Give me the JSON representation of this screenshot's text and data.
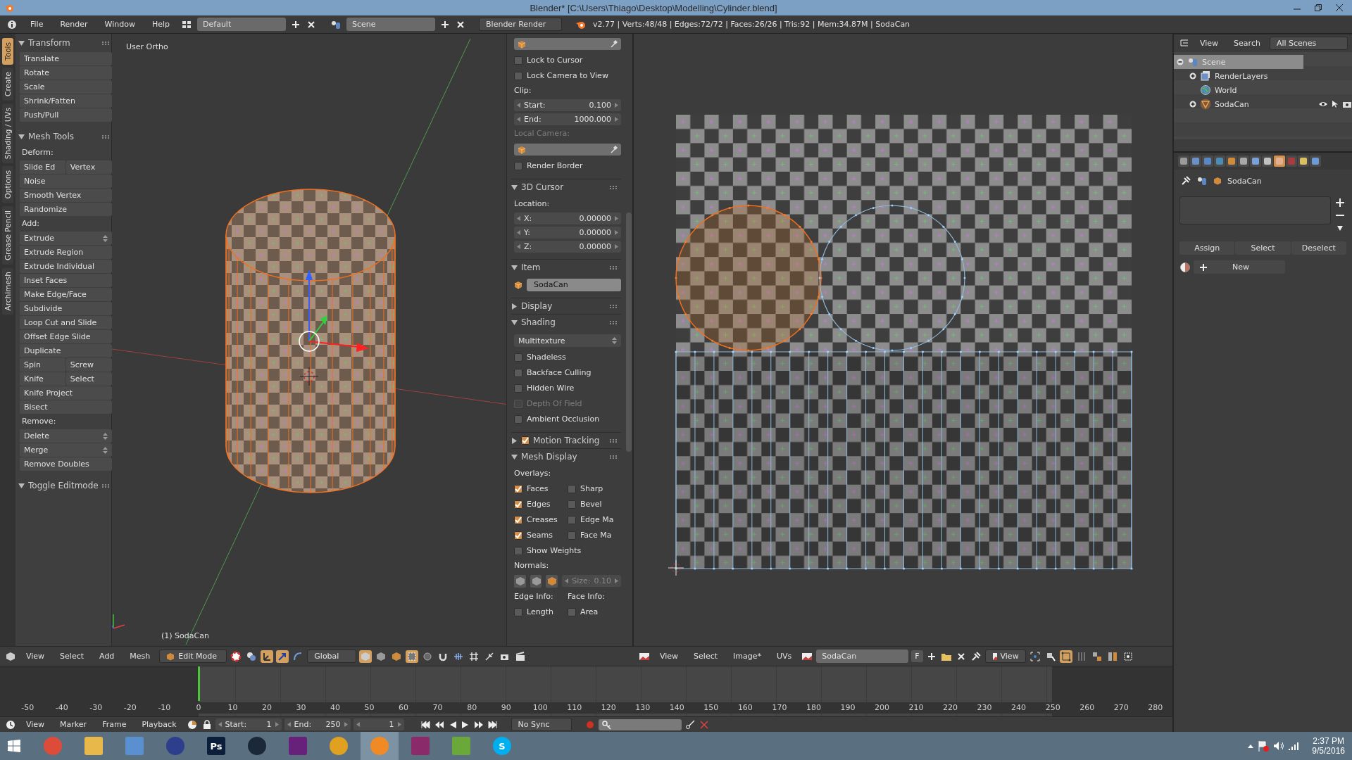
{
  "window": {
    "title": "Blender* [C:\\Users\\Thiago\\Desktop\\Modelling\\Cylinder.blend]"
  },
  "info_header": {
    "menus": [
      "File",
      "Render",
      "Window",
      "Help"
    ],
    "layout": "Default",
    "scene": "Scene",
    "engine": "Blender Render",
    "stats": "v2.77 | Verts:48/48 | Edges:72/72 | Faces:26/26 | Tris:92 | Mem:34.87M | SodaCan"
  },
  "tool_tabs": [
    {
      "label": "Tools",
      "selected": true
    },
    {
      "label": "Create",
      "selected": false
    },
    {
      "label": "Shading / UVs",
      "selected": false
    },
    {
      "label": "Options",
      "selected": false
    },
    {
      "label": "Grease Pencil",
      "selected": false
    },
    {
      "label": "Archimesh",
      "selected": false
    }
  ],
  "toolshelf": [
    {
      "title": "Transform",
      "expanded": true,
      "items": [
        {
          "kind": "button",
          "text": "Translate"
        },
        {
          "kind": "button",
          "text": "Rotate"
        },
        {
          "kind": "button",
          "text": "Scale"
        },
        {
          "kind": "button",
          "text": "Shrink/Fatten"
        },
        {
          "kind": "button",
          "text": "Push/Pull"
        }
      ]
    },
    {
      "title": "Mesh Tools",
      "expanded": true,
      "items": [
        {
          "kind": "label",
          "text": "Deform:"
        },
        {
          "kind": "pair",
          "texts": [
            "Slide Ed",
            "Vertex"
          ]
        },
        {
          "kind": "button",
          "text": "Noise"
        },
        {
          "kind": "button",
          "text": "Smooth Vertex"
        },
        {
          "kind": "button",
          "text": "Randomize"
        },
        {
          "kind": "label",
          "text": "Add:"
        },
        {
          "kind": "dropdown",
          "text": "Extrude"
        },
        {
          "kind": "button",
          "text": "Extrude Region"
        },
        {
          "kind": "button",
          "text": "Extrude Individual"
        },
        {
          "kind": "button",
          "text": "Inset Faces"
        },
        {
          "kind": "button",
          "text": "Make Edge/Face"
        },
        {
          "kind": "button",
          "text": "Subdivide"
        },
        {
          "kind": "button",
          "text": "Loop Cut and Slide"
        },
        {
          "kind": "button",
          "text": "Offset Edge Slide"
        },
        {
          "kind": "button",
          "text": "Duplicate"
        },
        {
          "kind": "pair",
          "texts": [
            "Spin",
            "Screw"
          ]
        },
        {
          "kind": "pair",
          "texts": [
            "Knife",
            "Select"
          ]
        },
        {
          "kind": "button",
          "text": "Knife Project"
        },
        {
          "kind": "button",
          "text": "Bisect"
        },
        {
          "kind": "label",
          "text": "Remove:"
        },
        {
          "kind": "dropdown",
          "text": "Delete"
        },
        {
          "kind": "dropdown",
          "text": "Merge"
        },
        {
          "kind": "button",
          "text": "Remove Doubles"
        }
      ]
    },
    {
      "title": "Toggle Editmode",
      "expanded": true
    }
  ],
  "viewport": {
    "view_label": "User Ortho",
    "object_label": "(1) SodaCan"
  },
  "n_panel": [
    {
      "items": [
        {
          "kind": "object-field"
        },
        {
          "kind": "checkbox",
          "label": "Lock to Cursor",
          "checked": false,
          "disabled": false
        },
        {
          "kind": "checkbox",
          "label": "Lock Camera to View",
          "checked": false,
          "disabled": false
        },
        {
          "kind": "label",
          "text": "Clip:",
          "disabled": false
        },
        {
          "kind": "number",
          "label": "Start:",
          "value": "0.100"
        },
        {
          "kind": "number",
          "label": "End:",
          "value": "1000.000"
        },
        {
          "kind": "label",
          "text": "Local Camera:",
          "disabled": true
        },
        {
          "kind": "object-field"
        },
        {
          "kind": "checkbox",
          "label": "Render Border",
          "checked": false,
          "disabled": false
        }
      ]
    },
    {
      "title": "3D Cursor",
      "expanded": true,
      "items": [
        {
          "kind": "label",
          "text": "Location:",
          "disabled": false
        },
        {
          "kind": "number",
          "label": "X:",
          "value": "0.00000"
        },
        {
          "kind": "number",
          "label": "Y:",
          "value": "0.00000"
        },
        {
          "kind": "number",
          "label": "Z:",
          "value": "0.00000"
        }
      ]
    },
    {
      "title": "Item",
      "expanded": true,
      "items": [
        {
          "kind": "name-field",
          "value": "SodaCan"
        }
      ]
    },
    {
      "title": "Display",
      "expanded": false
    },
    {
      "title": "Shading",
      "expanded": true,
      "items": [
        {
          "kind": "dropdown",
          "text": "Multitexture"
        },
        {
          "kind": "checkbox",
          "label": "Shadeless",
          "checked": false,
          "disabled": false
        },
        {
          "kind": "checkbox",
          "label": "Backface Culling",
          "checked": false,
          "disabled": false
        },
        {
          "kind": "checkbox",
          "label": "Hidden Wire",
          "checked": false,
          "disabled": false
        },
        {
          "kind": "checkbox",
          "label": "Depth Of Field",
          "checked": false,
          "disabled": true
        },
        {
          "kind": "checkbox",
          "label": "Ambient Occlusion",
          "checked": false,
          "disabled": false
        }
      ]
    },
    {
      "title": "Motion Tracking",
      "expanded": false,
      "checked": true
    },
    {
      "title": "Mesh Display",
      "expanded": true,
      "items": [
        {
          "kind": "label",
          "text": "Overlays:",
          "disabled": false
        },
        {
          "kind": "checkbox-pair",
          "boxes": [
            {
              "label": "Faces",
              "checked": true
            },
            {
              "label": "Sharp",
              "checked": false
            }
          ]
        },
        {
          "kind": "checkbox-pair",
          "boxes": [
            {
              "label": "Edges",
              "checked": true
            },
            {
              "label": "Bevel",
              "checked": false
            }
          ]
        },
        {
          "kind": "checkbox-pair",
          "boxes": [
            {
              "label": "Creases",
              "checked": true
            },
            {
              "label": "Edge Ma",
              "checked": false
            }
          ]
        },
        {
          "kind": "checkbox-pair",
          "boxes": [
            {
              "label": "Seams",
              "checked": true
            },
            {
              "label": "Face Ma",
              "checked": false
            }
          ]
        },
        {
          "kind": "checkbox",
          "label": "Show Weights",
          "checked": false,
          "disabled": false
        },
        {
          "kind": "label",
          "text": "Normals:",
          "disabled": false
        },
        {
          "kind": "normals",
          "size_label": "Size:",
          "size": "0.10"
        },
        {
          "kind": "label-pair",
          "texts": [
            "Edge Info:",
            "Face Info:"
          ]
        },
        {
          "kind": "checkbox-pair",
          "boxes": [
            {
              "label": "Length",
              "checked": false
            },
            {
              "label": "Area",
              "checked": false
            }
          ]
        }
      ]
    }
  ],
  "view3d_header": {
    "menus": [
      "View",
      "Select",
      "Add",
      "Mesh"
    ],
    "mode": "Edit Mode",
    "orientation": "Global"
  },
  "uv_header": {
    "menus": [
      "View",
      "Select",
      "Image*",
      "UVs"
    ],
    "image": "SodaCan",
    "fake_user": "F",
    "view_mode": "View"
  },
  "timeline": {
    "ticks": [
      "-50",
      "-40",
      "-30",
      "-20",
      "-10",
      "0",
      "10",
      "20",
      "30",
      "40",
      "50",
      "60",
      "70",
      "80",
      "90",
      "100",
      "110",
      "120",
      "130",
      "140",
      "150",
      "160",
      "170",
      "180",
      "190",
      "200",
      "210",
      "220",
      "230",
      "240",
      "250",
      "260",
      "270",
      "280"
    ]
  },
  "timeline_header": {
    "menus": [
      "View",
      "Marker",
      "Frame",
      "Playback"
    ],
    "start_label": "Start:",
    "start": "1",
    "end_label": "End:",
    "end": "250",
    "current": "1",
    "sync": "No Sync"
  },
  "outliner": {
    "menus": [
      "View",
      "Search"
    ],
    "filter": "All Scenes",
    "tree": [
      {
        "label": "Scene",
        "kind": "scene",
        "selected": true,
        "expanded": true,
        "children": [
          {
            "label": "RenderLayers",
            "kind": "render-layers",
            "selected": false,
            "expanded": false
          },
          {
            "label": "World",
            "kind": "world",
            "selected": false
          },
          {
            "label": "SodaCan",
            "kind": "mesh-object",
            "selected": false,
            "expanded": false
          }
        ]
      }
    ]
  },
  "properties": {
    "tabs": [
      {
        "color": "#9a9a9a",
        "selected": false
      },
      {
        "color": "#6d8fc8",
        "selected": false
      },
      {
        "color": "#5b86c4",
        "selected": false
      },
      {
        "color": "#4c8cb4",
        "selected": false
      },
      {
        "color": "#d08a3c",
        "selected": false
      },
      {
        "color": "#a8a8a8",
        "selected": false
      },
      {
        "color": "#7ba0d6",
        "selected": false
      },
      {
        "color": "#c0c0c0",
        "selected": false
      },
      {
        "color": "#e0b090",
        "selected": true
      },
      {
        "color": "#a83c3c",
        "selected": false
      },
      {
        "color": "#d8c060",
        "selected": false
      },
      {
        "color": "#6d9ad8",
        "selected": false
      }
    ],
    "breadcrumb": "SodaCan",
    "buttons": [
      "Assign",
      "Select",
      "Deselect"
    ],
    "new_label": "New"
  },
  "taskbar": {
    "apps": [
      {
        "kind": "round",
        "color": "#dd4b39",
        "selected": false
      },
      {
        "kind": "tile",
        "color": "#e8b84a",
        "selected": false
      },
      {
        "kind": "tile",
        "color": "#5a8fd0",
        "selected": false
      },
      {
        "kind": "round",
        "color": "#2c3e8c",
        "selected": false
      },
      {
        "kind": "tile",
        "color": "#0b1e3a",
        "glyph": "Ps",
        "selected": false
      },
      {
        "kind": "round",
        "color": "#1b2838",
        "selected": false
      },
      {
        "kind": "tile",
        "color": "#68217a",
        "selected": false
      },
      {
        "kind": "round",
        "color": "#e0a020",
        "selected": false
      },
      {
        "kind": "round",
        "color": "#f08a24",
        "selected": true
      },
      {
        "kind": "tile",
        "color": "#8a2a6a",
        "selected": false
      },
      {
        "kind": "tile",
        "color": "#6aa83a",
        "selected": false
      },
      {
        "kind": "round",
        "color": "#00aff0",
        "glyph": "S",
        "selected": false
      }
    ],
    "time": "2:37 PM",
    "date": "9/5/2016"
  }
}
